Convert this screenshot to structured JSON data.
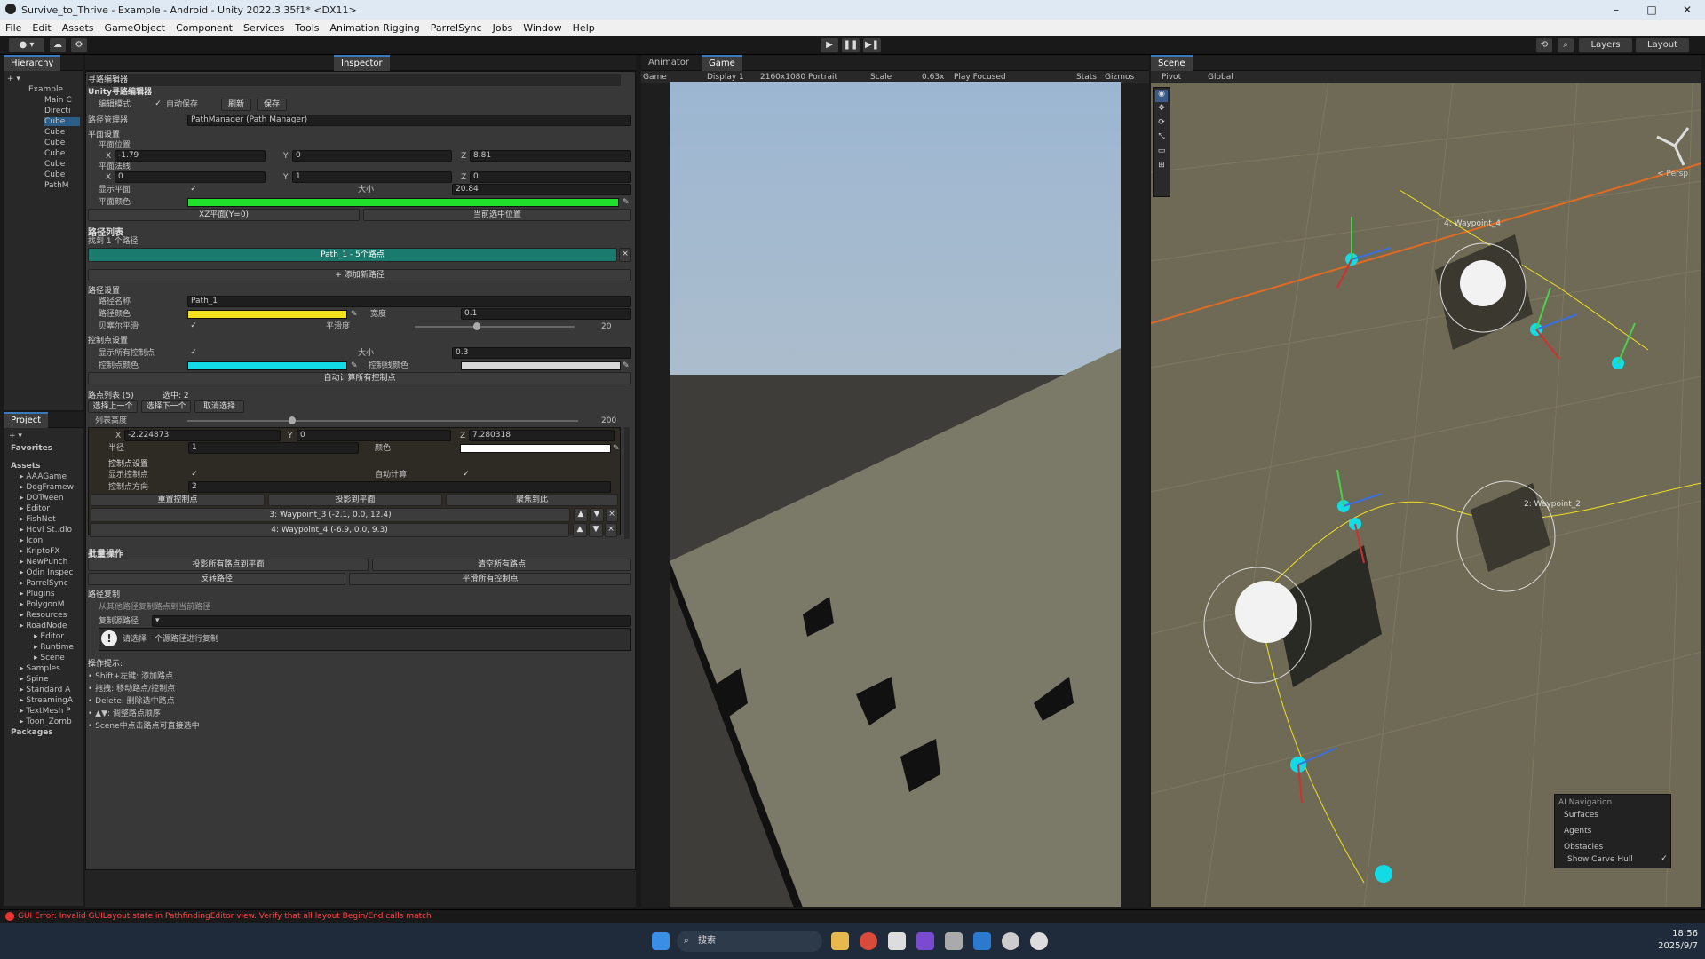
{
  "window": {
    "title": "Survive_to_Thrive - Example - Android - Unity 2022.3.35f1* <DX11>",
    "controls": [
      "–",
      "□",
      "✕"
    ]
  },
  "menu": [
    "File",
    "Edit",
    "Assets",
    "GameObject",
    "Component",
    "Services",
    "Tools",
    "Animation Rigging",
    "ParrelSync",
    "Jobs",
    "Window",
    "Help"
  ],
  "toolbar": {
    "layers": "Layers",
    "layout": "Layout",
    "play": "▶",
    "pause": "❚❚",
    "step": "▶❚"
  },
  "hierarchy": {
    "tab": "Hierarchy",
    "items": [
      "Example",
      "Main C",
      "Directi",
      "Cube",
      "Cube",
      "Cube",
      "Cube",
      "Cube",
      "Cube",
      "PathM"
    ]
  },
  "project": {
    "tab": "Project",
    "favorites": "Favorites",
    "assets_label": "Assets",
    "folders": [
      "AAAGame",
      "DogFramew",
      "DOTween",
      "Editor",
      "FishNet",
      "Hovl St..dio",
      "Icon",
      "KriptoFX",
      "NewPunch",
      "Odin Inspec",
      "ParrelSync",
      "Plugins",
      "PolygonM",
      "Resources",
      "RoadNode",
      "Editor",
      "Runtime",
      "Scene",
      "Samples",
      "Spine",
      "Standard A",
      "StreamingA",
      "TextMesh P",
      "Toon_Zomb"
    ],
    "packages": "Packages"
  },
  "inspector": {
    "tab": "Inspector",
    "window_title": "寻路编辑器",
    "subtitle": "Unity寻路编辑器",
    "edit_mode_label": "编辑模式",
    "auto_save_label": "自动保存",
    "refresh_btn": "刷新",
    "save_btn": "保存",
    "path_manager_label": "路径管理器",
    "path_manager_value": "PathManager (Path Manager)",
    "plane_section": "平面设置",
    "plane_pos_label": "平面位置",
    "plane_pos": {
      "x": "-1.79",
      "y": "0",
      "z": "8.81"
    },
    "plane_normal_label": "平面法线",
    "plane_normal": {
      "x": "0",
      "y": "1",
      "z": "0"
    },
    "show_plane_label": "显示平面",
    "size_label": "大小",
    "size_value": "20.84",
    "plane_color_label": "平面颜色",
    "plane_color": "#21e02b",
    "xz_plane_btn": "XZ平面(Y=0)",
    "current_sel_btn": "当前选中位置",
    "path_list_title": "路径列表",
    "found_paths": "找到 1 个路径",
    "path_item": "Path_1 - 5个路点",
    "add_path_btn": "+ 添加新路径",
    "path_settings": "路径设置",
    "path_name_label": "路径名称",
    "path_name": "Path_1",
    "path_color_label": "路径颜色",
    "path_color": "#f2e11c",
    "width_label": "宽度",
    "width_value": "0.1",
    "bezier_label": "贝塞尔平滑",
    "smooth_label": "平滑度",
    "smooth_value": "20",
    "control_section": "控制点设置",
    "show_ctrl_label": "显示所有控制点",
    "ctrl_size_label": "大小",
    "ctrl_size": "0.3",
    "ctrl_color_label": "控制点颜色",
    "ctrl_color": "#12dbe6",
    "ctrl_line_label": "控制线颜色",
    "ctrl_line_color": "#d8d8d8",
    "auto_calc_btn": "自动计算所有控制点",
    "waypoint_list_label": "路点列表 (5)",
    "selected_label": "选中: 2",
    "select_prev_btn": "选择上一个",
    "select_next_btn": "选择下一个",
    "cancel_sel_btn": "取消选择",
    "list_height_label": "列表高度",
    "list_height_value": "200",
    "wp_pos": {
      "x": "-2.224873",
      "y": "0",
      "z": "7.280318"
    },
    "radius_label": "半径",
    "radius_value": "1",
    "color_label": "颜色",
    "wp_color": "#ffffff",
    "wp_ctrl_section": "控制点设置",
    "show_ctrl2": "显示控制点",
    "auto_calc2": "自动计算",
    "ctrl_dir_label": "控制点方向",
    "ctrl_dir_value": "2",
    "reset_ctrl_btn": "重置控制点",
    "project_plane_btn": "投影到平面",
    "align_btn": "聚焦到此",
    "wp3": "3: Waypoint_3 (-2.1, 0.0, 12.4)",
    "wp4": "4: Waypoint_4 (-6.9, 0.0, 9.3)",
    "batch_title": "批量操作",
    "project_all_btn": "投影所有路点到平面",
    "clear_all_btn": "清空所有路点",
    "reverse_btn": "反转路径",
    "smooth_all_btn": "平滑所有控制点",
    "copy_title": "路径复制",
    "copy_desc": "从其他路径复制路点到当前路径",
    "source_label": "复制源路径",
    "info_text": "请选择一个源路径进行复制",
    "tips_title": "操作提示:",
    "tips": [
      "• Shift+左键: 添加路点",
      "• 拖拽: 移动路点/控制点",
      "• Delete: 删除选中路点",
      "• ▲▼: 调整路点顺序",
      "• Scene中点击路点可直接选中"
    ]
  },
  "game": {
    "tabs": [
      "Animator",
      "Game"
    ],
    "display": "Game",
    "display_num": "Display 1",
    "resolution": "2160x1080 Portrait",
    "scale_label": "Scale",
    "scale": "0.63x",
    "play_focused": "Play Focused",
    "stats": "Stats",
    "gizmos": "Gizmos"
  },
  "scene": {
    "tab": "Scene",
    "pivot": "Pivot",
    "global": "Global",
    "persp": "< Persp",
    "wp4_label": "4: Waypoint_4",
    "wp2_label": "2: Waypoint_2",
    "nav_title": "AI Navigation",
    "nav_items": [
      "Surfaces",
      "Agents",
      "Obstacles",
      "Show Carve Hull"
    ]
  },
  "status": {
    "error": "GUI Error: Invalid GUILayout state in PathfindingEditor view. Verify that all layout Begin/End calls match"
  },
  "taskbar": {
    "search": "搜索",
    "time": "18:56",
    "date": "2025/9/7"
  }
}
